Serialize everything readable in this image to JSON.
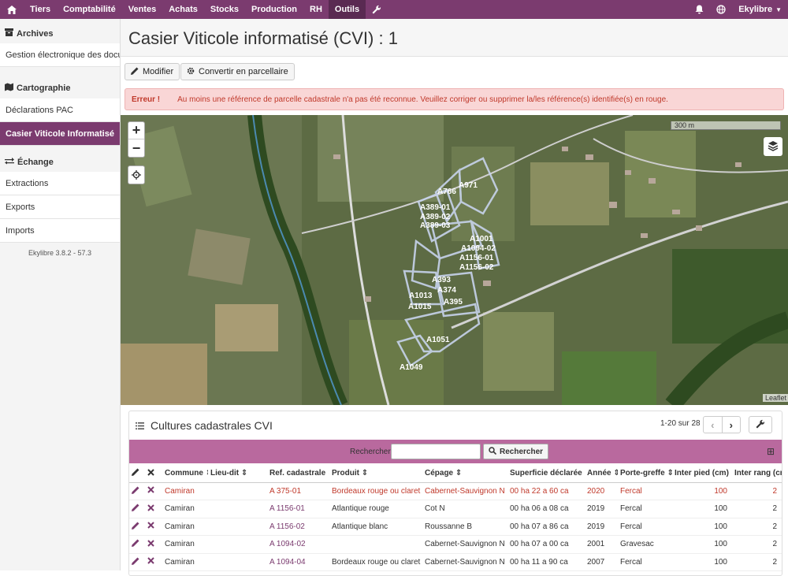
{
  "topbar": {
    "items": [
      "Tiers",
      "Comptabilité",
      "Ventes",
      "Achats",
      "Stocks",
      "Production",
      "RH",
      "Outils"
    ],
    "active": "Outils",
    "user": "Ekylibre"
  },
  "sidebar": {
    "archives": {
      "title": "Archives",
      "items": [
        "Gestion électronique des docu…"
      ]
    },
    "cartographie": {
      "title": "Cartographie",
      "items": [
        "Déclarations PAC",
        "Casier Viticole Informatisé"
      ]
    },
    "echange": {
      "title": "Échange",
      "items": [
        "Extractions",
        "Exports",
        "Imports"
      ]
    },
    "version": "Ekylibre 3.8.2 - 57.3"
  },
  "page": {
    "title": "Casier Viticole informatisé (CVI) : 1",
    "modify_label": "Modifier",
    "convert_label": "Convertir en parcellaire",
    "error_label": "Erreur !",
    "error_message": "Au moins une référence de parcelle cadastrale n'a pas été reconnue. Veuillez corriger ou supprimer la/les référence(s) identifiée(s) en rouge."
  },
  "map": {
    "scale_label": "300 m",
    "attribution": "Leaflet",
    "parcel_labels": [
      "A971",
      "A766",
      "A389-01",
      "A389-02",
      "A389-03",
      "A1001",
      "A1094-02",
      "A1156-01",
      "A1156-02",
      "A1013",
      "A1015",
      "A393",
      "A374",
      "A395",
      "A1051",
      "A1049"
    ]
  },
  "panel": {
    "title": "Cultures cadastrales CVI",
    "pagination": "1-20 sur 28",
    "search_label": "Rechercher",
    "search_placeholder": "",
    "search_button": "Rechercher",
    "columns": [
      "Commune",
      "Lieu-dit",
      "Ref. cadastrale",
      "Produit",
      "Cépage",
      "Superficie déclarée",
      "Année",
      "Porte-greffe",
      "Inter pied (cm)",
      "Inter rang (cm)"
    ],
    "rows": [
      {
        "commune": "Camiran",
        "lieu": "",
        "ref": "A 375-01",
        "produit": "Bordeaux rouge ou claret",
        "cepage": "Cabernet-Sauvignon N",
        "superficie": "00 ha 22 a 60 ca",
        "annee": "2020",
        "porte": "Fercal",
        "pied": "100",
        "rang": "2",
        "error": true
      },
      {
        "commune": "Camiran",
        "lieu": "",
        "ref": "A 1156-01",
        "produit": "Atlantique rouge",
        "cepage": "Cot N",
        "superficie": "00 ha 06 a 08 ca",
        "annee": "2019",
        "porte": "Fercal",
        "pied": "100",
        "rang": "2",
        "error": false
      },
      {
        "commune": "Camiran",
        "lieu": "",
        "ref": "A 1156-02",
        "produit": "Atlantique blanc",
        "cepage": "Roussanne B",
        "superficie": "00 ha 07 a 86 ca",
        "annee": "2019",
        "porte": "Fercal",
        "pied": "100",
        "rang": "2",
        "error": false
      },
      {
        "commune": "Camiran",
        "lieu": "",
        "ref": "A 1094-02",
        "produit": "",
        "cepage": "Cabernet-Sauvignon N",
        "superficie": "00 ha 07 a 00 ca",
        "annee": "2001",
        "porte": "Gravesac",
        "pied": "100",
        "rang": "2",
        "error": false
      },
      {
        "commune": "Camiran",
        "lieu": "",
        "ref": "A 1094-04",
        "produit": "Bordeaux rouge ou claret",
        "cepage": "Cabernet-Sauvignon N",
        "superficie": "00 ha 11 a 90 ca",
        "annee": "2007",
        "porte": "Fercal",
        "pied": "100",
        "rang": "2",
        "error": false
      }
    ]
  },
  "colors": {
    "brand": "#7b3b6f",
    "search_bar": "#b9699e",
    "error_text": "#c0392b",
    "error_bg": "#f9d6d6"
  }
}
